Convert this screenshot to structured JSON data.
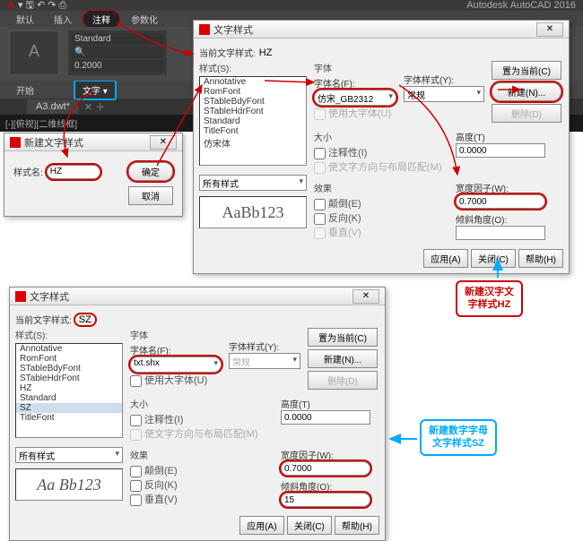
{
  "app": {
    "title": "Autodesk AutoCAD 2016",
    "logo": "A"
  },
  "tabs": {
    "items": [
      "默认",
      "插入",
      "注释",
      "参数化"
    ],
    "active": "注释"
  },
  "stylePanel": {
    "name": "Standard",
    "num": "0.2000"
  },
  "ribbonCat": {
    "active": "文字 ▾",
    "other": "开始"
  },
  "fileTab": "A3.dwt*",
  "viewportLabel": "[-][俯视][二维线框]",
  "newDlg": {
    "title": "新建文字样式",
    "label": "样式名:",
    "value": "HZ",
    "ok": "确定",
    "cancel": "取消"
  },
  "dlgMain": {
    "title": "文字样式",
    "curLabel": "当前文字样式:",
    "curVal": "HZ",
    "stylesLabel": "样式(S):",
    "styles": [
      "Annotative",
      "RomFont",
      "STableBdyFont",
      "STableHdrFont",
      "Standard",
      "TitleFont",
      "仿宋体"
    ],
    "filter": "所有样式",
    "preview": "AaBb123",
    "fontSection": "字体",
    "fontNameLabel": "字体名(F):",
    "fontName": "仿宋_GB2312",
    "fontStyleLabel": "字体样式(Y):",
    "fontStyle": "常规",
    "bigFontChk": "使用大字体(U)",
    "sizeSection": "大小",
    "annotChk": "注释性(I)",
    "matchChk": "使文字方向与布局匹配(M)",
    "heightLabel": "高度(T)",
    "height": "0.0000",
    "fxSection": "效果",
    "upsideChk": "颠倒(E)",
    "backChk": "反向(K)",
    "vertChk": "垂直(V)",
    "widthLabel": "宽度因子(W):",
    "width": "0.7000",
    "obliqLabel": "倾斜角度(O):",
    "setCurBtn": "置为当前(C)",
    "newBtn": "新建(N)...",
    "delBtn": "删除(D)",
    "applyBtn": "应用(A)",
    "closeBtn": "关闭(C)",
    "helpBtn": "帮助(H)"
  },
  "dlgSZ": {
    "title": "文字样式",
    "curLabel": "当前文字样式:",
    "curVal": "SZ",
    "stylesLabel": "样式(S):",
    "styles": [
      "Annotative",
      "RomFont",
      "STableBdyFont",
      "STableHdrFont",
      "HZ",
      "Standard",
      "SZ",
      "TitleFont"
    ],
    "filter": "所有样式",
    "preview": "Aa Bb123",
    "fontSection": "字体",
    "fontNameLabel": "字体名(F):",
    "fontName": "txt.shx",
    "fontStyleLabel": "字体样式(Y):",
    "fontStyle": "常规",
    "bigFontChk": "使用大字体(U)",
    "sizeSection": "大小",
    "annotChk": "注释性(I)",
    "matchChk": "使文字方向与布局匹配(M)",
    "heightLabel": "高度(T)",
    "height": "0.0000",
    "fxSection": "效果",
    "upsideChk": "颠倒(E)",
    "backChk": "反向(K)",
    "vertChk": "垂直(V)",
    "widthLabel": "宽度因子(W):",
    "width": "0.7000",
    "obliqLabel": "倾斜角度(O):",
    "obliq": "15",
    "setCurBtn": "置为当前(C)",
    "newBtn": "新建(N)...",
    "delBtn": "删除(D)",
    "applyBtn": "应用(A)",
    "closeBtn": "关闭(C)",
    "helpBtn": "帮助(H)"
  },
  "callouts": {
    "hz1": "新建汉字文",
    "hz2": "字样式HZ",
    "sz1": "新建数字字母",
    "sz2": "文字样式SZ"
  }
}
